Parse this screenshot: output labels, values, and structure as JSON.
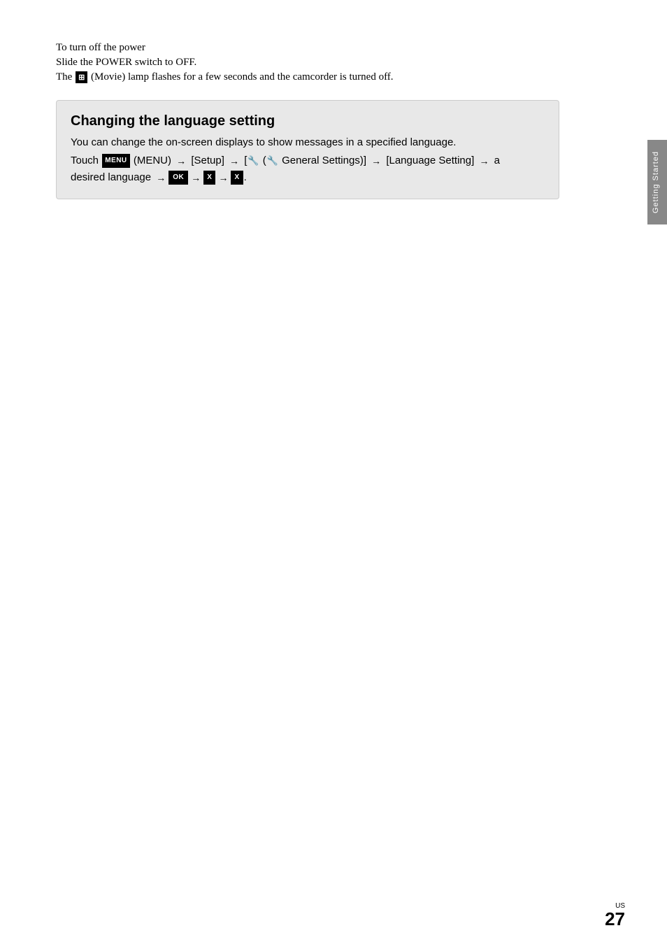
{
  "power_section": {
    "title": "To turn off the power",
    "line1": "Slide the POWER switch to OFF.",
    "line2_pre": "The ",
    "movie_icon": "⊞",
    "line2_post": " (Movie) lamp flashes for a few seconds and the camcorder is turned off."
  },
  "language_box": {
    "title": "Changing the language setting",
    "description": "You can change the on-screen displays to show messages in a specified language.",
    "instruction_touch": "Touch ",
    "menu_label": "MENU",
    "instruction_menu": " (MENU)",
    "arrow1": "→",
    "instruction_setup": " [Setup]",
    "arrow2": "→",
    "instruction_bracket_open": " [",
    "instruction_general": "General Settings)]",
    "arrow3": "→",
    "instruction_language": " [Language Setting]",
    "arrow4": "→",
    "instruction_lang2": " a desired language",
    "arrow5": "→",
    "ok_label": "OK",
    "arrow6": "→",
    "x1_label": "X",
    "arrow7": "→",
    "x2_label": "X",
    "period": "."
  },
  "side_tab": {
    "label": "Getting Started"
  },
  "page": {
    "label": "US",
    "number": "27"
  }
}
